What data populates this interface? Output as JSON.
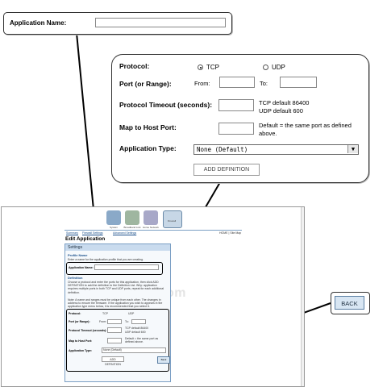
{
  "callout_appname": {
    "label": "Application Name:",
    "value": ""
  },
  "callout_protocol": {
    "protocol_label": "Protocol:",
    "tcp_label": "TCP",
    "udp_label": "UDP",
    "selected_protocol": "TCP",
    "port_range_label": "Port (or Range):",
    "from_label": "From:",
    "to_label": "To:",
    "timeout_label": "Protocol Timeout (seconds):",
    "tcp_default": "TCP default 86400",
    "udp_default": "UDP default 600",
    "map_host_port_label": "Map to Host Port:",
    "map_host_port_hint_1": "Default = the same port as defined",
    "map_host_port_hint_2": "above.",
    "app_type_label": "Application Type:",
    "app_type_value": "None (Default)",
    "add_definition_label": "ADD DEFINITION"
  },
  "callout_back": {
    "back_label": "BACK"
  },
  "mini_page": {
    "icons": [
      {
        "name": "System",
        "icon": "system-icon"
      },
      {
        "name": "Broadband Link",
        "icon": "broadband-icon"
      },
      {
        "name": "Home Network",
        "icon": "home-network-icon"
      },
      {
        "name": "Firewall",
        "icon": "firewall-icon"
      }
    ],
    "nav": [
      "Summary",
      "Firewall Settings",
      "Advanced Settings"
    ],
    "nav_right": "HOME | Site Map",
    "title": "Edit Application",
    "settings_label": "Settings",
    "profile_name_head": "Profile Name",
    "profile_hint": "Enter a name for the application profile that you are creating.",
    "app_name_label": "Application Name:",
    "definition_head": "Definition",
    "definition_text": "Choose a protocol and enter the ports for this application, then click ADD DEFINITION to add the definition to the Definition List. Why: application requires multiple ports in both TCP and UDP ports, repeat for each additional definition.",
    "note_text": "Note: A name and ranges must be unique from each other. The changes in address to ensure the firmware. If the application you wish to appears in the application type menu below, it is recommended that you select it.",
    "protocol_label": "Protocol:",
    "tcp": "TCP",
    "udp": "UDP",
    "port_label": "Port (or Range):",
    "from": "From:",
    "to": "To:",
    "timeout_label": "Protocol Timeout (seconds):",
    "tcp_default": "TCP default 86400",
    "udp_default": "UDP default 600",
    "map_label": "Map to Host Port:",
    "map_hint": "Default = the same port as defined above.",
    "apptype_label": "Application Type:",
    "apptype_value": "None (Default)",
    "add_def": "ADD DEFINITION",
    "back": "Back",
    "watermark": "ch.com"
  },
  "colors": {
    "accent": "#1a4f8b",
    "panel_border": "#7b9fc4",
    "back_fill": "#d8e6f3"
  }
}
